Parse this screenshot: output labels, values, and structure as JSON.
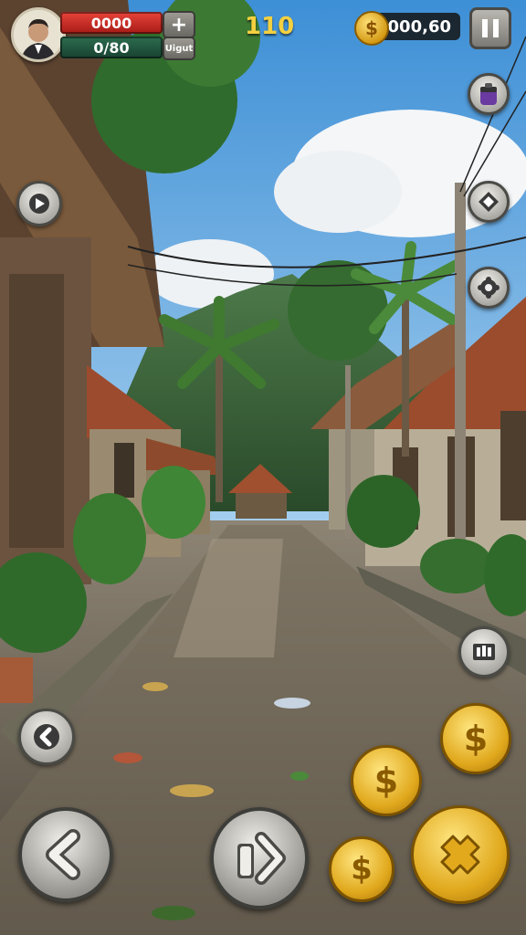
{
  "hud": {
    "health_value": "0000",
    "xp_value": "0/80",
    "add_symbol": "+",
    "small_label": "Uigut",
    "score": "110",
    "coins": "000,60",
    "coin_symbol": "$"
  },
  "colors": {
    "health_bar": "#d9342b",
    "xp_bar": "#235a40",
    "score_text": "#f4d040",
    "gold": "#e0a81c"
  },
  "icons": {
    "top_right": [
      "pause-icon",
      "backpack-icon",
      "tag-icon",
      "settings-icon"
    ],
    "left": [
      "sound-icon",
      "back-arrow-icon"
    ],
    "controls": [
      "left-arrow-icon",
      "right-arrow-icon",
      "inventory-icon",
      "action-cross-icon"
    ]
  }
}
